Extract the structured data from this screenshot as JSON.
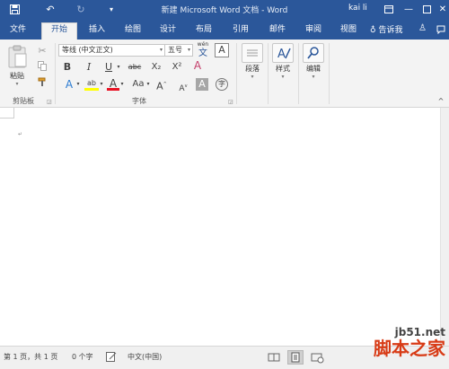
{
  "title_bar": {
    "title": "新建 Microsoft Word 文档 - Word",
    "user": "kai li"
  },
  "tabs": [
    {
      "label": "文件",
      "active": false
    },
    {
      "label": "开始",
      "active": true
    },
    {
      "label": "插入",
      "active": false
    },
    {
      "label": "绘图",
      "active": false
    },
    {
      "label": "设计",
      "active": false
    },
    {
      "label": "布局",
      "active": false
    },
    {
      "label": "引用",
      "active": false
    },
    {
      "label": "邮件",
      "active": false
    },
    {
      "label": "审阅",
      "active": false
    },
    {
      "label": "视图",
      "active": false
    }
  ],
  "tell_me": "告诉我",
  "ribbon": {
    "clipboard": {
      "paste_label": "粘贴",
      "group_label": "剪贴板"
    },
    "font": {
      "font_name": "等线 (中文正文)",
      "font_size": "五号",
      "wen_top": "wén",
      "wen_char": "文",
      "big_a": "A",
      "bold": "B",
      "italic": "I",
      "underline": "U",
      "strike": "abc",
      "subscript": "X₂",
      "superscript": "X²",
      "clear_format": "A",
      "text_effect": "A",
      "highlight": "ab",
      "font_color": "A",
      "change_case": "Aa",
      "grow": "A",
      "shrink": "A",
      "char_shade": "A",
      "enclose": "字",
      "group_label": "字体"
    },
    "paragraph": {
      "label": "段落"
    },
    "styles": {
      "label": "样式"
    },
    "editing": {
      "label": "编辑"
    }
  },
  "status_bar": {
    "page": "第 1 页，共 1 页",
    "words": "0 个字",
    "language": "中文(中国)"
  },
  "colors": {
    "word_blue": "#2b579a",
    "highlight_yellow": "#ffff00",
    "font_red": "#e81123"
  },
  "watermark": {
    "site": "jb51.net",
    "brand": "脚本之家"
  }
}
